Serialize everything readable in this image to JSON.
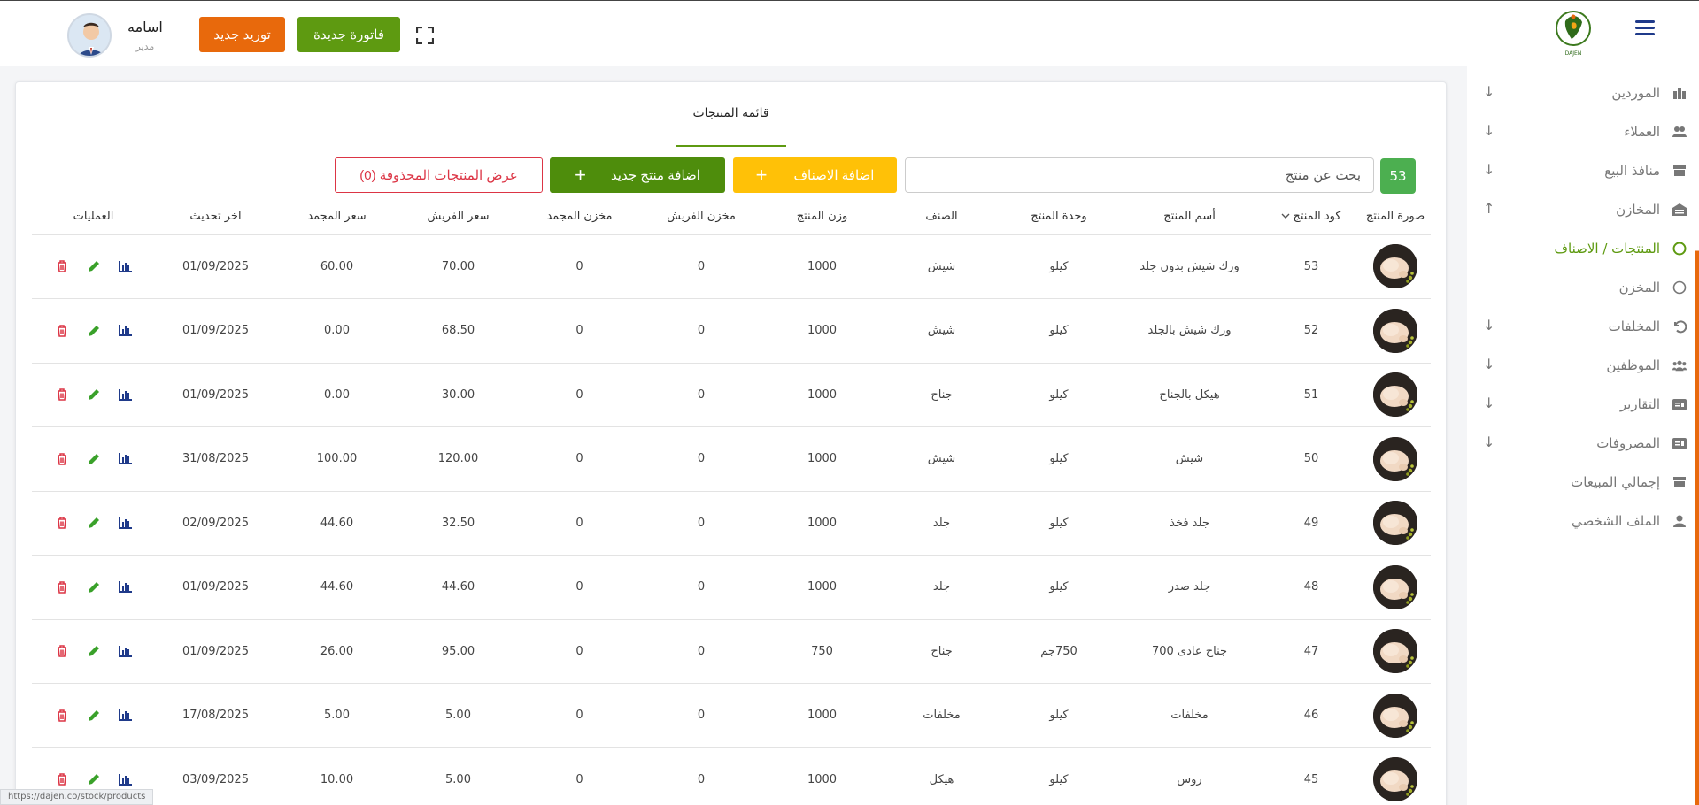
{
  "header": {
    "user_name": "اسامه",
    "user_role": "مدير",
    "supply_button": "توريد جديد",
    "invoice_button": "فاتورة جديدة",
    "logo_text": "DAJEN"
  },
  "sidebar": {
    "items": [
      {
        "label": "الموردين",
        "icon": "suppliers-icon",
        "arrow": "↓"
      },
      {
        "label": "العملاء",
        "icon": "customers-icon",
        "arrow": "↓"
      },
      {
        "label": "منافذ البيع",
        "icon": "store-icon",
        "arrow": "↓"
      },
      {
        "label": "المخازن",
        "icon": "warehouse-icon",
        "arrow": "↑"
      },
      {
        "label": "المنتجات / الاصناف",
        "icon": "circle-icon",
        "arrow": ""
      },
      {
        "label": "المخزن",
        "icon": "circle-icon",
        "arrow": ""
      },
      {
        "label": "المخلفات",
        "icon": "undo-icon",
        "arrow": "↓"
      },
      {
        "label": "الموظفين",
        "icon": "employees-icon",
        "arrow": "↓"
      },
      {
        "label": "التقارير",
        "icon": "reports-icon",
        "arrow": "↓"
      },
      {
        "label": "المصروفات",
        "icon": "expenses-icon",
        "arrow": "↓"
      },
      {
        "label": "إجمالي المبيعات",
        "icon": "sales-icon",
        "arrow": ""
      },
      {
        "label": "الملف الشخصي",
        "icon": "profile-icon",
        "arrow": ""
      }
    ]
  },
  "main": {
    "title": "قائمة المنتجات",
    "count": "53",
    "search_placeholder": "بحث عن منتج",
    "add_categories_button": "اضافة الاصناف",
    "add_product_button": "اضافة منتج جديد",
    "deleted_products_button": "عرض المنتجات المحذوفة (0)"
  },
  "table": {
    "headers": [
      "صورة المنتج",
      "كود المنتج",
      "أسم المنتج",
      "وحدة المنتج",
      "الصنف",
      "وزن المنتج",
      "مخزن الفريش",
      "مخزن المجمد",
      "سعر الفريش",
      "سعر المجمد",
      "اخر تحديث",
      "العمليات"
    ],
    "rows": [
      [
        "53",
        "ورك شيش بدون جلد",
        "كيلو",
        "شيش",
        "1000",
        "0",
        "0",
        "70.00",
        "60.00",
        "01/09/2025"
      ],
      [
        "52",
        "ورك شيش بالجلد",
        "كيلو",
        "شيش",
        "1000",
        "0",
        "0",
        "68.50",
        "0.00",
        "01/09/2025"
      ],
      [
        "51",
        "هيكل بالجناح",
        "كيلو",
        "جناح",
        "1000",
        "0",
        "0",
        "30.00",
        "0.00",
        "01/09/2025"
      ],
      [
        "50",
        "شيش",
        "كيلو",
        "شيش",
        "1000",
        "0",
        "0",
        "120.00",
        "100.00",
        "31/08/2025"
      ],
      [
        "49",
        "جلد فخذ",
        "كيلو",
        "جلد",
        "1000",
        "0",
        "0",
        "32.50",
        "44.60",
        "02/09/2025"
      ],
      [
        "48",
        "جلد صدر",
        "كيلو",
        "جلد",
        "1000",
        "0",
        "0",
        "44.60",
        "44.60",
        "01/09/2025"
      ],
      [
        "47",
        "جناح عادى 700",
        "750جم",
        "جناح",
        "750",
        "0",
        "0",
        "95.00",
        "26.00",
        "01/09/2025"
      ],
      [
        "46",
        "مخلفات",
        "كيلو",
        "مخلفات",
        "1000",
        "0",
        "0",
        "5.00",
        "5.00",
        "17/08/2025"
      ],
      [
        "45",
        "روس",
        "كيلو",
        "هيكل",
        "1000",
        "0",
        "0",
        "5.00",
        "10.00",
        "03/09/2025"
      ]
    ]
  },
  "status_url": "https://dajen.co/stock/products",
  "colors": {
    "brand_green": "#5e9a11",
    "supply_orange": "#e8690c",
    "categories_yellow": "#ffc107",
    "danger_red": "#dc3545",
    "nav_blue": "#1f3a8a"
  }
}
